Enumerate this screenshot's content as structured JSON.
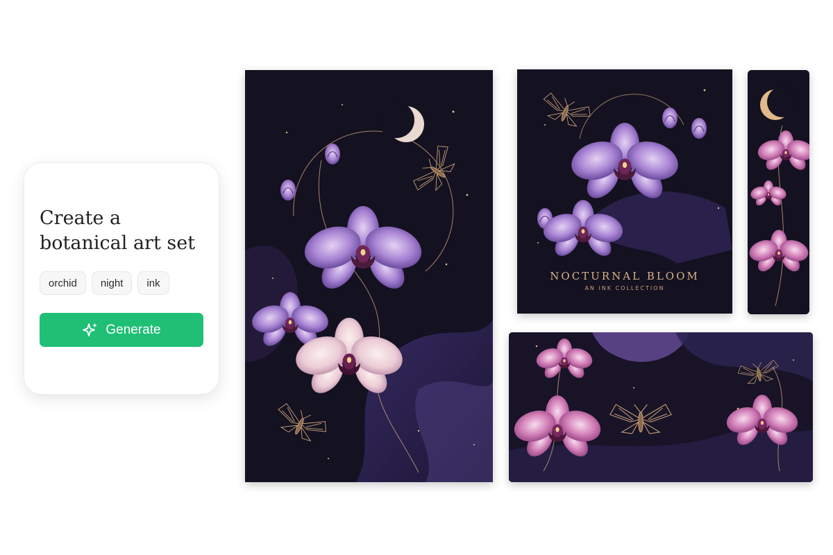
{
  "prompt_card": {
    "headline": "Create a botanical art set",
    "tags": [
      "orchid",
      "night",
      "ink"
    ],
    "generate_label": "Generate"
  },
  "artworks": {
    "poster_title": "NOCTURNAL BLOOM",
    "poster_subtitle": "AN INK COLLECTION"
  },
  "colors": {
    "accent_green": "#1fbf76",
    "canvas_dark": "#12101d",
    "orchid_purple": "#9a6fc8",
    "orchid_pink": "#c86aa6",
    "orchid_cream": "#efd6dc",
    "gold_line": "#c9a27c"
  },
  "icons": {
    "generate": "sparkle-icon",
    "moon": "crescent-moon-icon",
    "moth": "moth-icon",
    "orchid": "orchid-flower-icon"
  }
}
